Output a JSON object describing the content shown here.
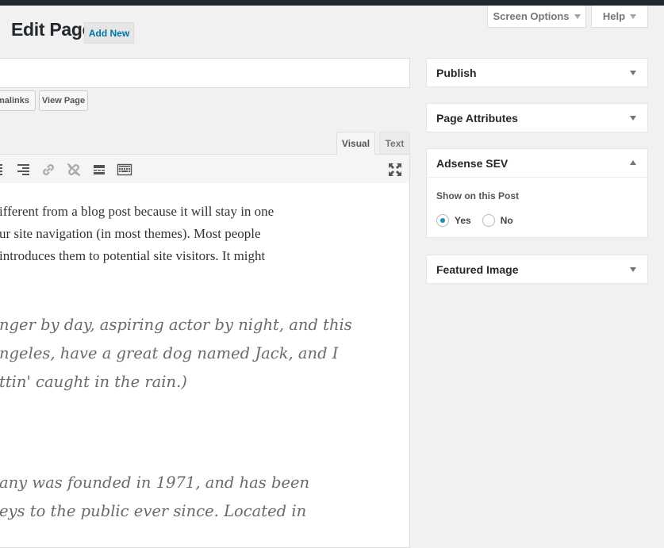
{
  "header": {
    "page_title": "Edit Page",
    "add_new_label": "Add New",
    "screen_options_label": "Screen Options",
    "help_label": "Help"
  },
  "title_area": {
    "permalinks_button_label": "rmalinks",
    "view_page_button_label": "View Page"
  },
  "editor": {
    "tabs": [
      "Visual",
      "Text"
    ],
    "active_tab": "Visual",
    "toolbar_icons": [
      "align-center-icon",
      "align-right-icon",
      "insert-link-icon",
      "remove-link-icon",
      "read-more-icon",
      "toolbar-toggle-icon",
      "fullscreen-icon"
    ],
    "paragraph_lines": [
      "ifferent from a blog post because it will stay in one",
      "ur site navigation (in most themes). Most people",
      "introduces them to potential site visitors. It might"
    ],
    "quote1_lines": [
      "nger by day, aspiring actor by night, and this",
      "ngeles, have a great dog named Jack, and I",
      "ttin' caught in the rain.)"
    ],
    "quote2_lines": [
      "any was founded in 1971, and has been",
      "eys to the public ever since. Located in"
    ]
  },
  "sidebar": {
    "publish_title": "Publish",
    "page_attributes_title": "Page Attributes",
    "adsense": {
      "title": "Adsense SEV",
      "label": "Show on this Post",
      "options": [
        "Yes",
        "No"
      ],
      "selected": "Yes"
    },
    "featured_image_title": "Featured Image"
  },
  "colors": {
    "admin_bar": "#23282d",
    "background": "#f1f1f1",
    "link": "#0073aa",
    "radio_checked": "#1e8cbe"
  }
}
